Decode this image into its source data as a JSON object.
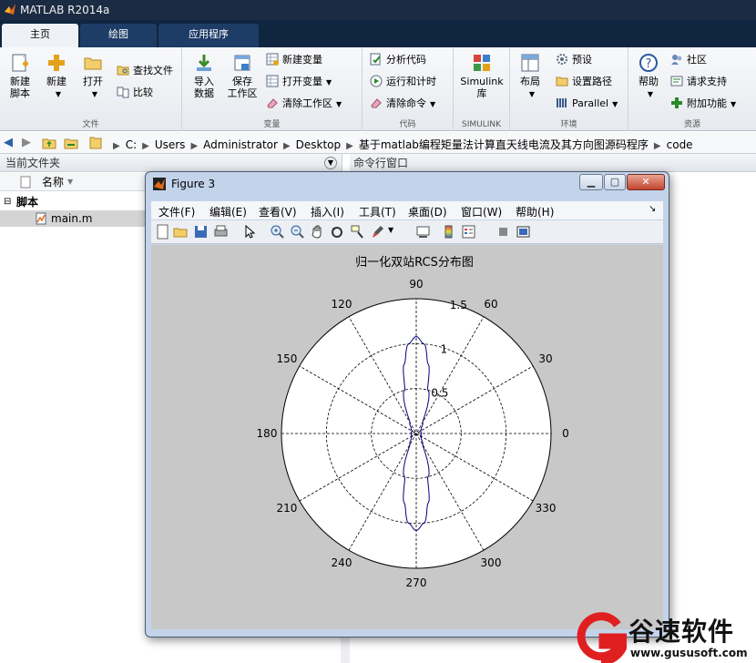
{
  "app": {
    "title": "MATLAB R2014a"
  },
  "tabs": [
    {
      "label": "主页"
    },
    {
      "label": "绘图"
    },
    {
      "label": "应用程序"
    }
  ],
  "ribbon": {
    "file_group": {
      "name": "文件",
      "new_script": "新建\n脚本",
      "new_script_l1": "新建",
      "new_script_l2": "脚本",
      "new": "新建",
      "open": "打开",
      "find_files": "查找文件",
      "compare": "比较"
    },
    "variable_group": {
      "name": "变量",
      "import": "导入",
      "import_l2": "数据",
      "save": "保存",
      "save_l2": "工作区",
      "new_var": "新建变量",
      "open_var": "打开变量",
      "clear_ws": "清除工作区"
    },
    "code_group": {
      "name": "代码",
      "analyze": "分析代码",
      "run_time": "运行和计时",
      "clear_cmd": "清除命令"
    },
    "simulink_group": {
      "name": "SIMULINK",
      "simulink": "Simulink",
      "simulink_l2": "库"
    },
    "env_group": {
      "name": "环境",
      "layout": "布局",
      "prefs": "预设",
      "set_path": "设置路径",
      "parallel": "Parallel"
    },
    "resources_group": {
      "name": "资源",
      "help": "帮助",
      "community": "社区",
      "support": "请求支持",
      "addons": "附加功能"
    }
  },
  "address": {
    "segments": [
      "C:",
      "Users",
      "Administrator",
      "Desktop",
      "基于matlab编程矩量法计算直天线电流及其方向图源码程序",
      "code"
    ]
  },
  "current_folder": {
    "title": "当前文件夹",
    "col_name": "名称",
    "group_label": "脚本",
    "file": "main.m"
  },
  "command_window": {
    "title": "命令行窗口"
  },
  "figure": {
    "title": "Figure 3",
    "menu": [
      "文件(F)",
      "编辑(E)",
      "查看(V)",
      "插入(I)",
      "工具(T)",
      "桌面(D)",
      "窗口(W)",
      "帮助(H)"
    ]
  },
  "chart_data": {
    "type": "polar",
    "title": "归一化双站RCS分布图",
    "r_ticks": [
      "0.5",
      "1",
      "1.5"
    ],
    "angle_ticks": [
      "0",
      "30",
      "60",
      "90",
      "120",
      "150",
      "180",
      "210",
      "240",
      "270",
      "300",
      "330"
    ],
    "rlim": [
      0,
      1.5
    ],
    "series": [
      {
        "color": "#00007f",
        "theta_deg": [
          0,
          15,
          30,
          45,
          60,
          75,
          80,
          85,
          90,
          95,
          100,
          105,
          120,
          135,
          150,
          165,
          180,
          195,
          210,
          225,
          240,
          255,
          260,
          265,
          270,
          275,
          280,
          285,
          300,
          315,
          330,
          345,
          360
        ],
        "r": [
          0.05,
          0.06,
          0.05,
          0.08,
          0.14,
          0.5,
          0.78,
          1.0,
          1.08,
          1.0,
          0.78,
          0.5,
          0.14,
          0.08,
          0.05,
          0.06,
          0.05,
          0.06,
          0.05,
          0.08,
          0.14,
          0.5,
          0.78,
          1.0,
          1.08,
          1.0,
          0.78,
          0.5,
          0.14,
          0.08,
          0.05,
          0.06,
          0.05
        ]
      }
    ]
  },
  "watermark": {
    "brand": "谷速软件",
    "url": "www.gususoft.com"
  },
  "colors": {
    "ribbon_dark": "#10253f",
    "plot_line": "#00007f",
    "fig_bg": "#c8c8c8"
  }
}
